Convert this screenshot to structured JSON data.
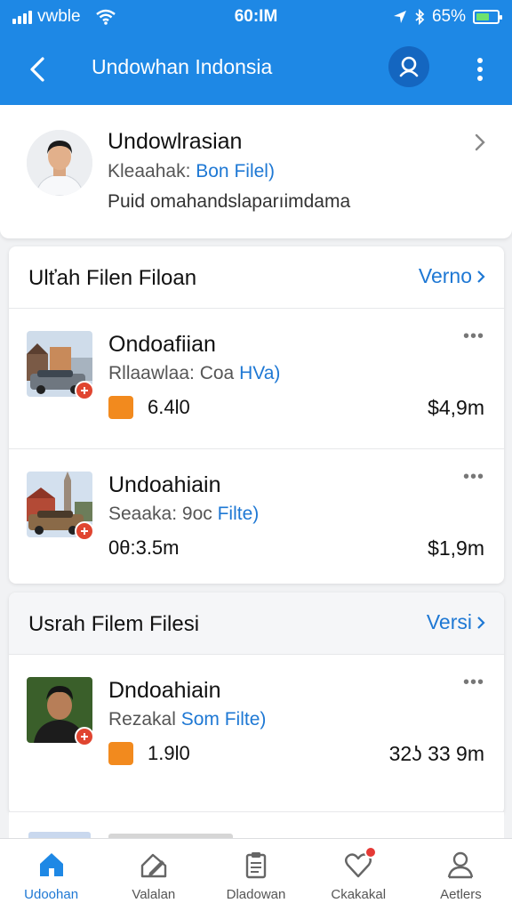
{
  "status_bar": {
    "carrier": "vwble",
    "time": "60:IM",
    "battery": "65%",
    "battery_level": 0.65
  },
  "app_bar": {
    "title": "Undowhan Indonsia",
    "icons": [
      "chevron-left-icon",
      "search-icon",
      "more-vertical-icon"
    ]
  },
  "profile": {
    "name": "Undowlrasian",
    "sub_label": "Kleaahak:",
    "sub_link": "Bon Filel)",
    "description": "Puid omahandslaparıimdama"
  },
  "sections": [
    {
      "title": "Ulťah  Filen Filoan",
      "link": "Verno",
      "items": [
        {
          "title": "Ondoafiian",
          "sub_label": "Rllaawlaa: Coa",
          "sub_link": "HVa)",
          "left_value": "6.4l0",
          "right_value": "$4,9m",
          "show_tag": true
        },
        {
          "title": "Undoahiain",
          "sub_label": "Seaaka: 9oc",
          "sub_link": "Filte)",
          "left_value": "0θ:3.5m",
          "right_value": "$1,9m",
          "show_tag": false
        }
      ]
    },
    {
      "title": "Usrah  Filem  Filesi",
      "link": "Versi",
      "items": [
        {
          "title": "Dndoahiain",
          "sub_label": "Rezakal",
          "sub_link": "Som Filte)",
          "left_value": "1.9l0",
          "right_value": "32ʖ 33 9m",
          "show_tag": true
        }
      ]
    }
  ],
  "tabs": [
    {
      "label": "Udoohan",
      "icon": "home-icon",
      "active": true
    },
    {
      "label": "Valalan",
      "icon": "folder-edit-icon",
      "active": false
    },
    {
      "label": "Dladowan",
      "icon": "clipboard-icon",
      "active": false
    },
    {
      "label": "Ckakakal",
      "icon": "heart-icon",
      "active": false,
      "badge": true
    },
    {
      "label": "Aetlers",
      "icon": "user-icon",
      "active": false
    }
  ],
  "colors": {
    "primary": "#1e88e5",
    "link": "#1e78d4",
    "tag": "#f28a1e",
    "badge": "#e04530"
  }
}
